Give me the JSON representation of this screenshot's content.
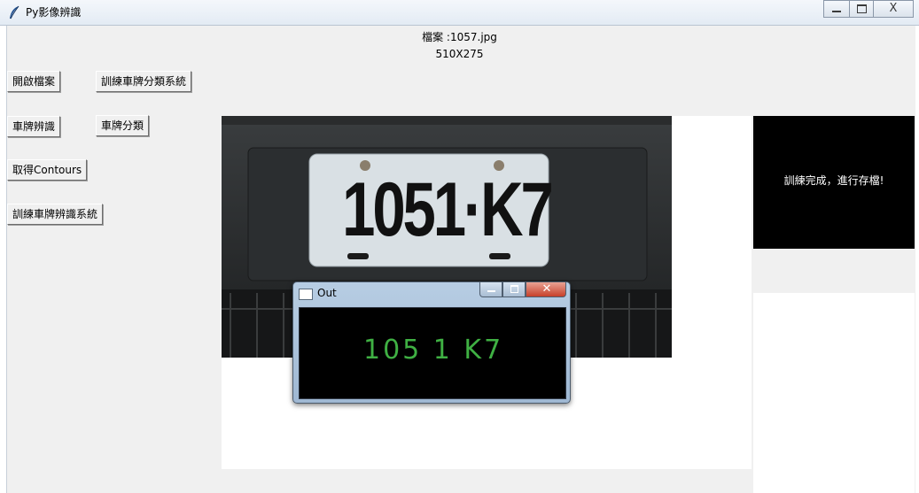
{
  "window": {
    "title": "Py影像辨識",
    "icon": "feather-icon",
    "controls": [
      "minimize-icon",
      "maximize-icon",
      "close-icon"
    ],
    "close_glyph": "X"
  },
  "file": {
    "name": "檔案 :1057.jpg",
    "size": "510X275"
  },
  "buttons": {
    "open_file": "開啟檔案",
    "train_classifier": "訓練車牌分類系統",
    "recognize_plate": "車牌辨識",
    "classify_plate": "車牌分類",
    "get_contours": "取得Contours",
    "train_recognizer": "訓練車牌辨識系統"
  },
  "photo": {
    "plate_text": "1051·K7"
  },
  "status_message": "訓練完成，進行存檔!",
  "out_window": {
    "title": "Out",
    "result_text": "105 1 K7",
    "close_glyph": "✕"
  },
  "colors": {
    "result_text": "#3fb043",
    "close_button": "#c7402a"
  }
}
